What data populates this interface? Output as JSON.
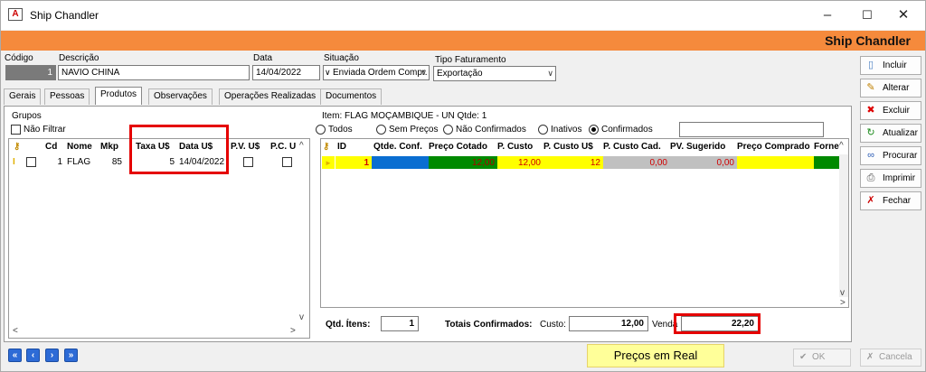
{
  "window": {
    "title": "Ship Chandler",
    "banner_title": "Ship Chandler",
    "min": "–",
    "max": "☐",
    "close": "✕"
  },
  "header": {
    "codigo_label": "Código",
    "codigo_value": "1",
    "descricao_label": "Descrição",
    "descricao_value": "NAVIO CHINA",
    "data_label": "Data",
    "data_value": "14/04/2022",
    "situacao_label": "Situação",
    "situacao_value": "Enviada Ordem Compr.",
    "tipo_label": "Tipo Faturamento",
    "tipo_value": "Exportação"
  },
  "tabs": [
    "Gerais",
    "Pessoas",
    "Produtos",
    "Observações",
    "Operações Realizadas",
    "Documentos"
  ],
  "active_tab": "Produtos",
  "grupos": {
    "label": "Grupos",
    "nao_filtrar": "Não Filtrar"
  },
  "left_grid": {
    "headers": [
      "Cd",
      "Nome",
      "Mkp",
      "Taxa U$",
      "Data U$",
      "P.V. U$",
      "P.C. U"
    ],
    "rows": [
      {
        "cd": "1",
        "nome": "FLAG",
        "mkp": "85",
        "taxa": "5",
        "data": "14/04/2022"
      }
    ]
  },
  "item": {
    "label": "Item: FLAG MOÇAMBIQUE - UN Qtde: 1",
    "filters": [
      "Todos",
      "Sem Preços",
      "Não Confirmados",
      "Inativos",
      "Confirmados"
    ],
    "selected_filter": "Confirmados"
  },
  "right_grid": {
    "headers": [
      "ID",
      "Qtde. Conf.",
      "Preço Cotado",
      "P. Custo",
      "P. Custo U$",
      "P. Custo Cad.",
      "PV. Sugerido",
      "Preço Comprado",
      "Forne"
    ],
    "rows": [
      {
        "id": "1",
        "qtde": "",
        "preco_cotado": "12,00",
        "p_custo": "12,00",
        "p_custo_us": "12",
        "p_custo_cad": "0,00",
        "pv_sugerido": "0,00"
      }
    ]
  },
  "totals": {
    "qtd_itens_label": "Qtd. Ítens:",
    "qtd_itens_value": "1",
    "totais_label": "Totais Confirmados:",
    "custo_label": "Custo:",
    "custo_value": "12,00",
    "venda_label": "Venda",
    "venda_value": "22,20"
  },
  "buttons": [
    "Incluir",
    "Alterar",
    "Excluir",
    "Atualizar",
    "Procurar",
    "Imprimir",
    "Fechar"
  ],
  "bottom": {
    "tooltip": "Preços em Real",
    "ok": "OK",
    "cancel": "Cancela"
  },
  "colors": {
    "banner": "#f58a3c",
    "highlight": "#ffff00",
    "blue_cell": "#0a6ed1",
    "green_cell": "#008a00",
    "gray_cell": "#c0c0c0",
    "red_box": "#e50000"
  }
}
